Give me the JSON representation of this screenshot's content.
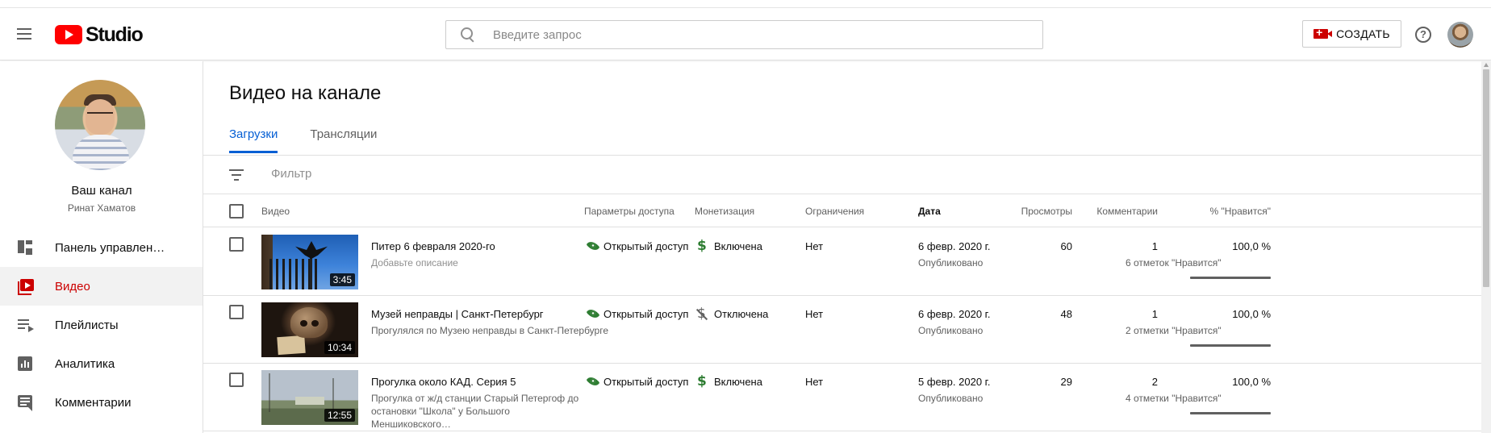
{
  "header": {
    "logo_text": "Studio",
    "search_placeholder": "Введите запрос",
    "create_label": "СОЗДАТЬ",
    "help_symbol": "?"
  },
  "sidebar": {
    "channel_title": "Ваш канал",
    "channel_owner": "Ринат Хаматов",
    "items": [
      {
        "label": "Панель управлен…",
        "icon": "dashboard-icon",
        "active": false
      },
      {
        "label": "Видео",
        "icon": "video-icon",
        "active": true
      },
      {
        "label": "Плейлисты",
        "icon": "playlist-icon",
        "active": false
      },
      {
        "label": "Аналитика",
        "icon": "analytics-icon",
        "active": false
      },
      {
        "label": "Комментарии",
        "icon": "comments-icon",
        "active": false
      }
    ]
  },
  "main": {
    "title": "Видео на канале",
    "tabs": [
      {
        "label": "Загрузки",
        "active": true
      },
      {
        "label": "Трансляции",
        "active": false
      }
    ],
    "filter_placeholder": "Фильтр",
    "columns": {
      "video": "Видео",
      "visibility": "Параметры доступа",
      "monetization": "Монетизация",
      "restrictions": "Ограничения",
      "date": "Дата",
      "views": "Просмотры",
      "comments": "Комментарии",
      "likes": "% \"Нравится\""
    },
    "rows": [
      {
        "title": "Питер 6 февраля 2020-го",
        "description": "Добавьте описание",
        "duration": "3:45",
        "visibility": "Открытый доступ",
        "monetization": "Включена",
        "monetization_on": true,
        "restrictions": "Нет",
        "date": "6 февр. 2020 г.",
        "status": "Опубликовано",
        "views": "60",
        "comments": "1",
        "likes_pct": "100,0 %",
        "likes_count": "6 отметок \"Нравится\"",
        "likes_ratio": 1.0
      },
      {
        "title": "Музей неправды | Санкт-Петербург",
        "description": "Прогулялся по Музею неправды в Санкт-Петербурге",
        "duration": "10:34",
        "visibility": "Открытый доступ",
        "monetization": "Отключена",
        "monetization_on": false,
        "restrictions": "Нет",
        "date": "6 февр. 2020 г.",
        "status": "Опубликовано",
        "views": "48",
        "comments": "1",
        "likes_pct": "100,0 %",
        "likes_count": "2 отметки \"Нравится\"",
        "likes_ratio": 1.0
      },
      {
        "title": "Прогулка около КАД. Серия 5",
        "description": "Прогулка от ж/д станции Старый Петергоф до остановки \"Школа\" у Большого Меншиковского…",
        "duration": "12:55",
        "visibility": "Открытый доступ",
        "monetization": "Включена",
        "monetization_on": true,
        "restrictions": "Нет",
        "date": "5 февр. 2020 г.",
        "status": "Опубликовано",
        "views": "29",
        "comments": "2",
        "likes_pct": "100,0 %",
        "likes_count": "4 отметки \"Нравится\"",
        "likes_ratio": 1.0
      }
    ]
  },
  "colors": {
    "brand_red": "#ff0000",
    "active_red": "#cc0000",
    "tab_blue": "#065fd4",
    "public_green": "#2e7d32"
  }
}
